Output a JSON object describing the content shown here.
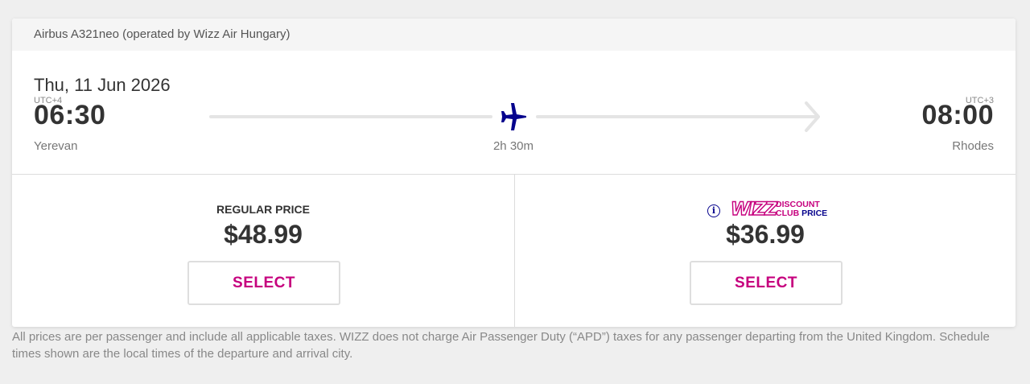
{
  "flight": {
    "aircraft": "Airbus A321neo (operated by Wizz Air Hungary)",
    "date": "Thu, 11 Jun 2026",
    "departure": {
      "utc": "UTC+4",
      "time": "06:30",
      "city": "Yerevan"
    },
    "arrival": {
      "utc": "UTC+3",
      "time": "08:00",
      "city": "Rhodes"
    },
    "duration": "2h 30m",
    "plane_icon": "plane-icon",
    "route_color": "#e4e4e4"
  },
  "fares": {
    "regular": {
      "label": "REGULAR PRICE",
      "price": "$48.99",
      "button": "SELECT"
    },
    "discount": {
      "info_icon": "info-icon",
      "logo_text": "WIZZ",
      "label_line1": "DISCOUNT",
      "label_line2_a": "CLUB",
      "label_line2_b": "PRICE",
      "price": "$36.99",
      "button": "SELECT"
    }
  },
  "disclaimer": "All prices are per passenger and include all applicable taxes. WIZZ does not charge Air Passenger Duty (“APD”) taxes for any passenger departing from the United Kingdom. Schedule times shown are the local times of the departure and arrival city.",
  "colors": {
    "brand_magenta": "#c6007e",
    "brand_navy": "#06038d",
    "text_dark": "#333333",
    "text_muted": "#777777",
    "background": "#efefef"
  }
}
